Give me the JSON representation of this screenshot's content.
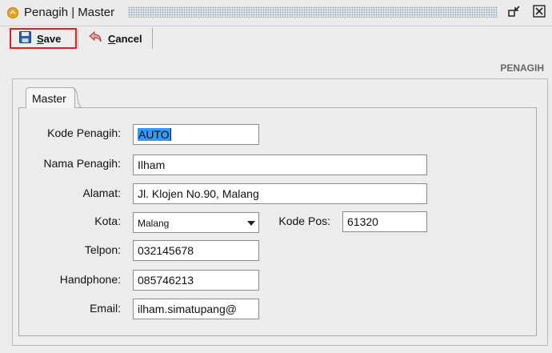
{
  "window": {
    "title": "Penagih | Master"
  },
  "toolbar": {
    "save_label": "Save",
    "cancel_label": "Cancel"
  },
  "section_caption": "PENAGIH",
  "tabs": [
    {
      "label": "Master"
    }
  ],
  "form": {
    "kode_penagih": {
      "label": "Kode Penagih:",
      "value": "AUTO"
    },
    "nama_penagih": {
      "label": "Nama Penagih:",
      "value": "Ilham"
    },
    "alamat": {
      "label": "Alamat:",
      "value": "Jl. Klojen No.90, Malang"
    },
    "kota": {
      "label": "Kota:",
      "value": "Malang"
    },
    "kode_pos": {
      "label": "Kode Pos:",
      "value": "61320"
    },
    "telpon": {
      "label": "Telpon:",
      "value": "032145678"
    },
    "handphone": {
      "label": "Handphone:",
      "value": "085746213"
    },
    "email": {
      "label": "Email:",
      "value": "ilham.simatupang@"
    }
  },
  "icons": {
    "app": "app-logo-icon",
    "restore": "restore-window-icon",
    "close": "close-window-icon",
    "save": "floppy-disk-icon",
    "cancel": "undo-arrow-icon",
    "dropdown": "chevron-down-icon"
  },
  "colors": {
    "highlight": "#3399ff",
    "focus_border": "#e02020",
    "app_icon": "#f0a020"
  }
}
